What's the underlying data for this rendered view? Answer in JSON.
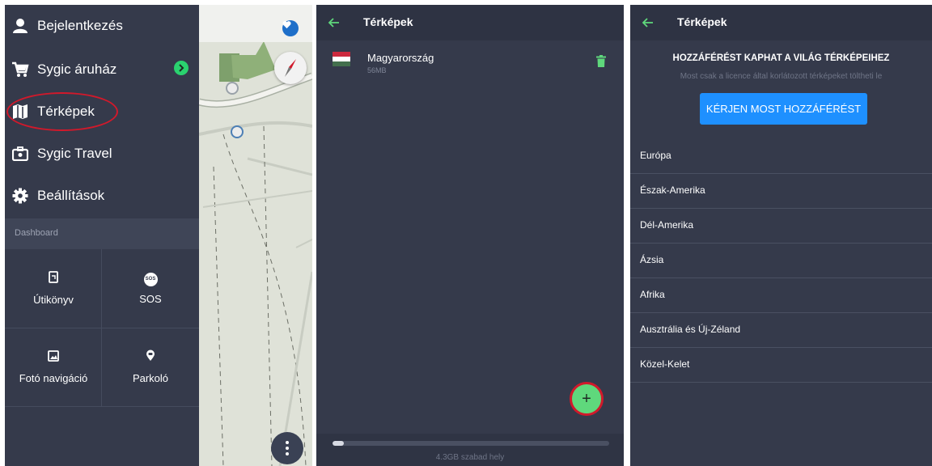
{
  "screen1": {
    "menu": [
      {
        "label": "Bejelentkezés",
        "icon": "person-icon"
      },
      {
        "label": "Sygic áruház",
        "icon": "cart-icon"
      },
      {
        "label": "Térképek",
        "icon": "map-icon"
      },
      {
        "label": "Sygic Travel",
        "icon": "suitcase-icon"
      },
      {
        "label": "Beállítások",
        "icon": "gear-icon"
      }
    ],
    "dashboard_header": "Dashboard",
    "dashboard_tiles": [
      {
        "label": "Útikönyv",
        "icon": "guidebook-icon"
      },
      {
        "label": "SOS",
        "icon": "sos-icon",
        "icon_text": "SOS"
      },
      {
        "label": "Fotó navigáció",
        "icon": "photo-icon"
      },
      {
        "label": "Parkoló",
        "icon": "parking-pin-icon"
      }
    ]
  },
  "screen2": {
    "title": "Térképek",
    "maps": [
      {
        "name": "Magyarország",
        "size": "56MB",
        "flag_colors": [
          "#cd2a3e",
          "#ffffff",
          "#436f4d"
        ]
      }
    ],
    "fab_label": "+",
    "storage_text": "4.3GB szabad hely",
    "storage_used_fraction": 0.04
  },
  "screen3": {
    "title": "Térképek",
    "promo_title": "HOZZÁFÉRÉST KAPHAT A VILÁG TÉRKÉPEIHEZ",
    "promo_subtitle": "Most csak a licence által korlátozott térképeket töltheti le",
    "promo_button": "KÉRJEN MOST HOZZÁFÉRÉST",
    "regions": [
      "Európa",
      "Észak-Amerika",
      "Dél-Amerika",
      "Ázsia",
      "Afrika",
      "Ausztrália és Új-Zéland",
      "Közel-Kelet"
    ]
  },
  "colors": {
    "background": "#353a4b",
    "appbar": "#2e3343",
    "accent_green": "#5fd87c",
    "highlight_red": "#d1192b",
    "button_blue": "#1e90ff"
  }
}
